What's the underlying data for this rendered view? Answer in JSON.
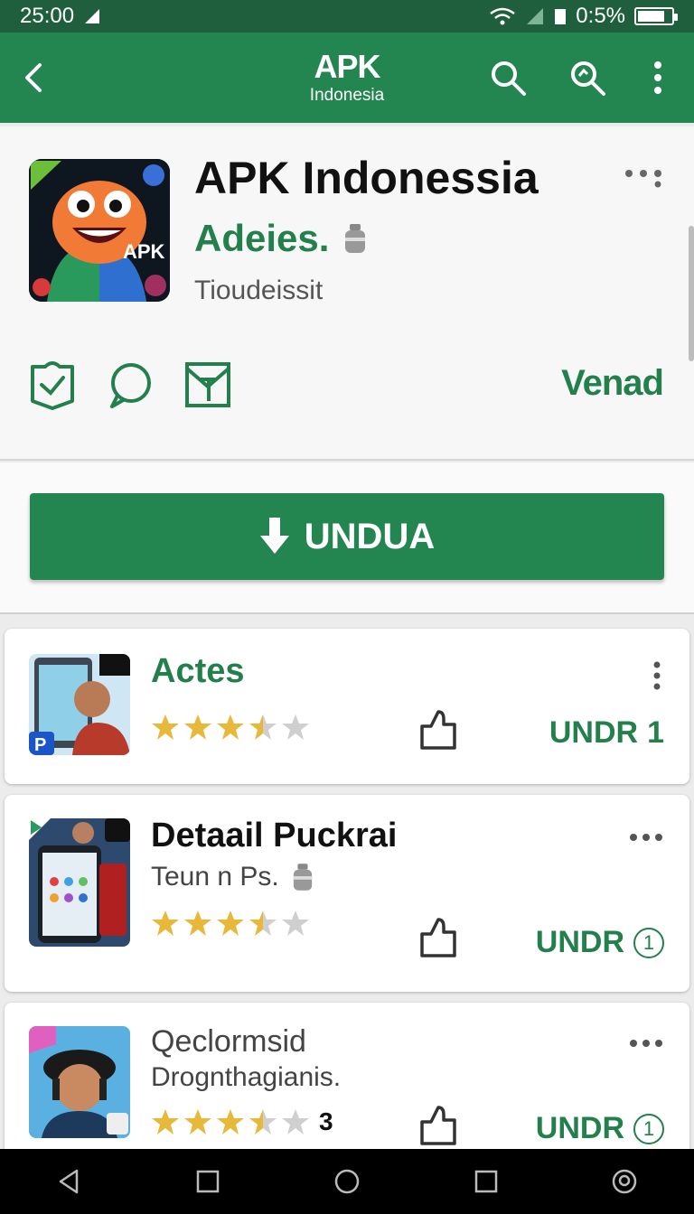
{
  "status_bar": {
    "time": "25:00",
    "battery_text": "0:5%",
    "battery_level": 0.8
  },
  "app_bar": {
    "title": "APK",
    "subtitle": "Indonesia"
  },
  "app": {
    "title": "APK Indonessia",
    "developer": "Adeies.",
    "category": "Tioudeissit",
    "icon_text": "APK",
    "verified_label": "Venad"
  },
  "download_button": {
    "label": "UNDUA"
  },
  "list": [
    {
      "title": "Actes",
      "subtitle": "",
      "rating": 3.5,
      "rating_count": "",
      "action": "UNDR",
      "action_badge": "1",
      "menu": "kebab"
    },
    {
      "title": "Detaail Puckrai",
      "subtitle": "Teun n Ps.",
      "rating": 3.5,
      "rating_count": "",
      "action": "UNDR",
      "action_badge": "1",
      "menu": "dots"
    },
    {
      "title": "Qeclormsid",
      "subtitle": "Drognthagianis.",
      "rating": 3.5,
      "rating_count": "3",
      "action": "UNDR",
      "action_badge": "1",
      "menu": "dots"
    }
  ],
  "colors": {
    "primary": "#23854f",
    "primary_dark": "#1f5f3e",
    "star": "#e8b83a"
  }
}
